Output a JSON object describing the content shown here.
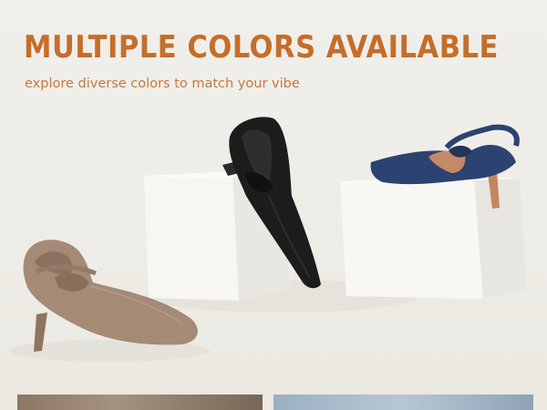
{
  "banner": {
    "headline": "MULTIPLE COLORS AVAILABLE",
    "subline": "explore diverse colors to match your vibe"
  },
  "products": [
    {
      "color_name": "taupe",
      "swatch": "#a58a76"
    },
    {
      "color_name": "black",
      "swatch": "#1c1c1c"
    },
    {
      "color_name": "navy",
      "swatch": "#2c4270"
    }
  ],
  "colors": {
    "background": "#efede8",
    "headline": "#c46e2b",
    "subline": "#c27a43"
  }
}
